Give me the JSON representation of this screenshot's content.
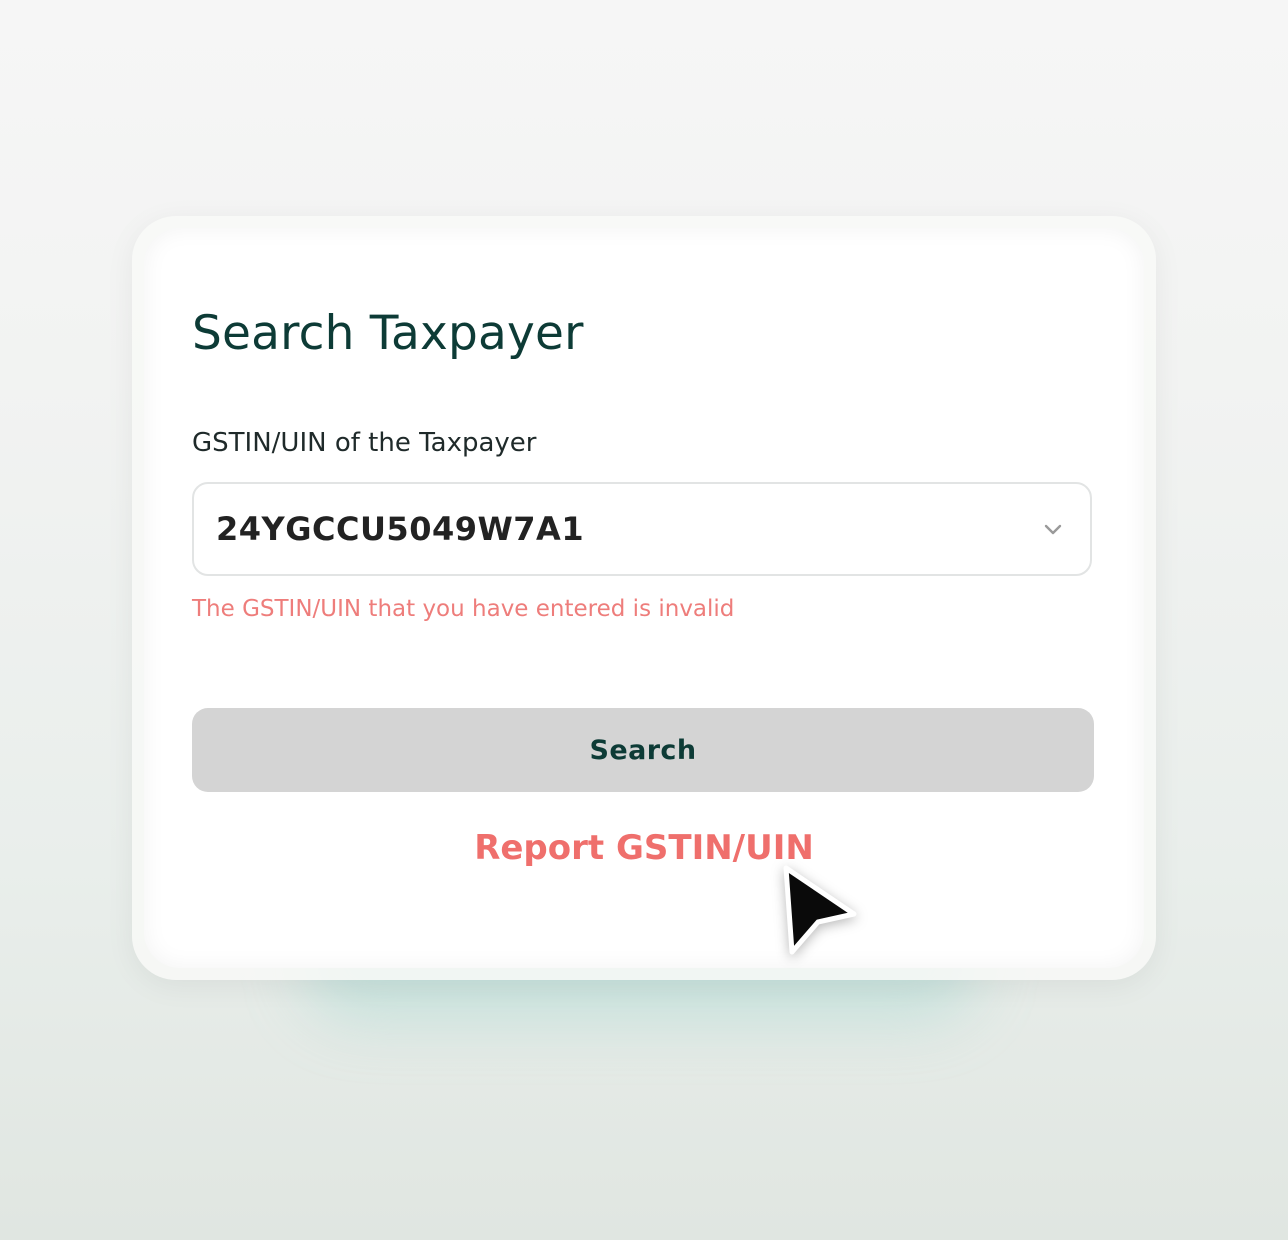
{
  "form": {
    "title": "Search Taxpayer",
    "field_label": "GSTIN/UIN of the Taxpayer",
    "field_value": "24YGCCU5049W7A1",
    "error_message": "The GSTIN/UIN that you have entered is invalid",
    "search_label": "Search",
    "report_label": "Report GSTIN/UIN"
  },
  "icons": {
    "dropdown": "chevron-down-icon",
    "pointer": "mouse-pointer-icon"
  },
  "colors": {
    "title": "#0d3b36",
    "error": "#ee7d7b",
    "link": "#ef6f6c",
    "button_bg": "#d4d4d4"
  }
}
